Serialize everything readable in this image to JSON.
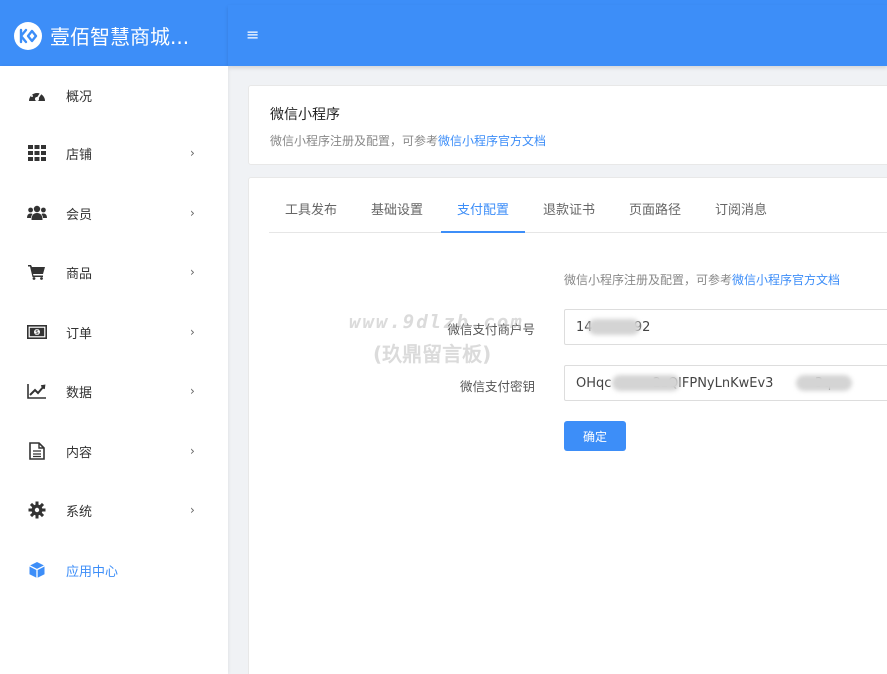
{
  "brand": {
    "name": "壹佰智慧商城..."
  },
  "header": {
    "menu_toggle": "≡"
  },
  "sidebar": {
    "items": [
      {
        "label": "概况",
        "icon": "dashboard-icon",
        "has_arrow": false,
        "active": false
      },
      {
        "label": "店铺",
        "icon": "grid-icon",
        "has_arrow": true,
        "active": false
      },
      {
        "label": "会员",
        "icon": "users-icon",
        "has_arrow": true,
        "active": false
      },
      {
        "label": "商品",
        "icon": "cart-icon",
        "has_arrow": true,
        "active": false
      },
      {
        "label": "订单",
        "icon": "money-icon",
        "has_arrow": true,
        "active": false
      },
      {
        "label": "数据",
        "icon": "line-chart-icon",
        "has_arrow": true,
        "active": false
      },
      {
        "label": "内容",
        "icon": "document-icon",
        "has_arrow": true,
        "active": false
      },
      {
        "label": "系统",
        "icon": "gear-icon",
        "has_arrow": true,
        "active": false
      },
      {
        "label": "应用中心",
        "icon": "cube-icon",
        "has_arrow": false,
        "active": true
      }
    ],
    "arrow": "›"
  },
  "page_header": {
    "title": "微信小程序",
    "desc": "微信小程序注册及配置，可参考",
    "desc_link": "微信小程序官方文档"
  },
  "tabs": [
    {
      "label": "工具发布",
      "active": false
    },
    {
      "label": "基础设置",
      "active": false
    },
    {
      "label": "支付配置",
      "active": true
    },
    {
      "label": "退款证书",
      "active": false
    },
    {
      "label": "页面路径",
      "active": false
    },
    {
      "label": "订阅消息",
      "active": false
    }
  ],
  "form": {
    "hint": "微信小程序注册及配置，可参考",
    "hint_link": "微信小程序官方文档",
    "merchant_label": "微信支付商户号",
    "merchant_value": "14          92",
    "secret_label": "微信支付密钥",
    "secret_value": "OHqc          2zQIFPNyLnKwEv3          3q",
    "submit_label": "确定"
  },
  "watermark": {
    "line1": "www.9dlzb.com",
    "line2": "(玖鼎留言板)"
  },
  "colors": {
    "primary": "#3d8ef8",
    "sidebar_bg": "#ffffff",
    "page_bg": "#f0f2f5"
  }
}
